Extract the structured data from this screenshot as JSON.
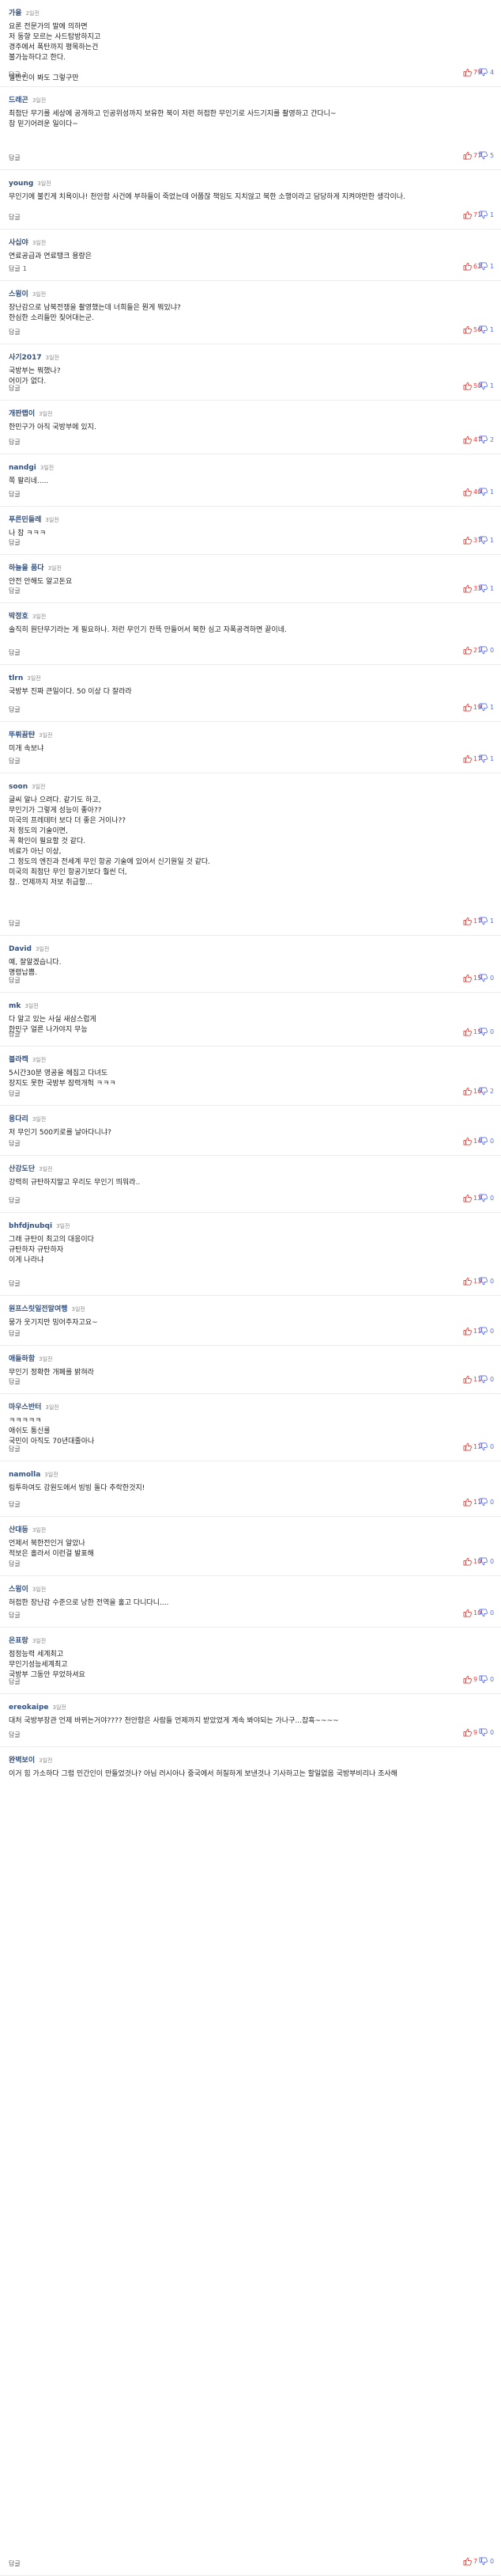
{
  "labels": {
    "reply": "답글"
  },
  "colors": {
    "like": "#e2433c",
    "dislike": "#5a6ff0",
    "nickname": "#33507e"
  },
  "comments": [
    {
      "nickname": "가을",
      "date": "2일전",
      "body": "요론 전문가의 말에 의하면\n저 동향 모르는 사드탐방하지고\n경주에서 폭탄까지 평목하는건\n불가능하다고 한다.\n\n일반인이 봐도 그렇구만",
      "reply_count": "2",
      "likes": "79",
      "dislikes": "4"
    },
    {
      "nickname": "드래곤",
      "date": "3일전",
      "body": "최첨단 무기를 세상에 공개하고 인공위성까지 보유한 북이 저런 허접한 무인기로 사드기지를 촬영하고 간다니~\n참 믿기어려운 일이다~",
      "reply_count": "",
      "likes": "77",
      "dislikes": "5"
    },
    {
      "nickname": "young",
      "date": "3일전",
      "body": "무인기에 불킨게 치욕이나! 천안함 사건에 부하들이 죽었는데 어쭙잖 책임도 지치않고 북한 소행이라고 담당하게 지켜야만한 생각이나.",
      "reply_count": "",
      "likes": "71",
      "dislikes": "1"
    },
    {
      "nickname": "사십야",
      "date": "3일전",
      "body": "연료공급과  연료탱크 용량은",
      "reply_count": "1",
      "likes": "62",
      "dislikes": "1"
    },
    {
      "nickname": "스윙이",
      "date": "3일전",
      "body": "장난감으로 남북전쟁을 촬영했는데    너희들은 뭔게 뭐있냐?\n한심한 소리들만 짖어대는군.",
      "reply_count": "",
      "likes": "56",
      "dislikes": "1"
    },
    {
      "nickname": "사기2017",
      "date": "3일전",
      "body": "국방부는 뭐했나?\n어이가 없다.",
      "reply_count": "",
      "likes": "50",
      "dislikes": "1"
    },
    {
      "nickname": "개판랩이",
      "date": "3일전",
      "body": "한민구가 아직 국방부에 있지.",
      "reply_count": "",
      "likes": "47",
      "dislikes": "2"
    },
    {
      "nickname": "nandgi",
      "date": "3일전",
      "body": "쪽 팔리네.....",
      "reply_count": "",
      "likes": "40",
      "dislikes": "1"
    },
    {
      "nickname": "푸른민들레",
      "date": "3일전",
      "body": "나 참 ㅋㅋㅋ",
      "reply_count": "",
      "likes": "37",
      "dislikes": "1"
    },
    {
      "nickname": "하늘을 품다",
      "date": "3일전",
      "body": "안전 안해도 알고돈요",
      "reply_count": "",
      "likes": "33",
      "dislikes": "1"
    },
    {
      "nickname": "박정호",
      "date": "3일전",
      "body": "솔직히 원단무기라는 게 필요하나. 저런 무인기 잔뜩 만들어서 북한 심고 자폭공격하면 끝이네.",
      "reply_count": "",
      "likes": "21",
      "dislikes": "0"
    },
    {
      "nickname": "tlrn",
      "date": "3일전",
      "body": "국방부 진짜 큰일이다. 50 이상 다 잘라라",
      "reply_count": "",
      "likes": "19",
      "dislikes": "1"
    },
    {
      "nickname": "뚜뤼뀸탼",
      "date": "3일전",
      "body": "미개 속보냐",
      "reply_count": "",
      "likes": "17",
      "dislikes": "1"
    },
    {
      "nickname": "soon",
      "date": "3일전",
      "body": "글씨 알나 으려다. 같기도 하고,\n무인기가 그렇게 성능이 좋아??\n미국의 프레데터 보다 더 좋은 거이나??\n저 정도의 기술이면,\n꼭 확인이 필요할 것 같다.\n비료가 아닌 이상,\n그 정도의 엔진과 전세계 무인 항공 기술에 있어서  신기원일 것 같다.\n미국의 최첨단 무인 항공기보다 훨씬 더,\n참.. 언제까지 저보 취급할...",
      "reply_count": "",
      "likes": "17",
      "dislikes": "1"
    },
    {
      "nickname": "David",
      "date": "3일전",
      "body": "예, 잘알겠습니다.\n명령납쁨.",
      "reply_count": "",
      "likes": "15",
      "dislikes": "0"
    },
    {
      "nickname": "mk",
      "date": "3일전",
      "body": "다 알고 있는 사실 새삼스럽게\n한민구 얼른 나가야지 무능",
      "reply_count": "",
      "likes": "15",
      "dislikes": "0"
    },
    {
      "nickname": "블라켁",
      "date": "3일전",
      "body": "5시간30분 영공을 헤집고 다녀도\n장지도 못한 국방부 잠력개헉 ㅋㅋㅋ",
      "reply_count": "",
      "likes": "16",
      "dislikes": "2"
    },
    {
      "nickname": "용다리",
      "date": "3일전",
      "body": "저 무인기 500키로를 날아다니냐?",
      "reply_count": "",
      "likes": "14",
      "dislikes": "0"
    },
    {
      "nickname": "산강도단",
      "date": "3일전",
      "body": "강력히 규탄하지말고 우리도 무인기 띄워라..",
      "reply_count": "",
      "likes": "13",
      "dislikes": "0"
    },
    {
      "nickname": "bhfdjnubqi",
      "date": "3일전",
      "body": "그래 규탄이 최고의 대응이다\n규탄하자 규탄하자\n이게 나라냐",
      "reply_count": "",
      "likes": "13",
      "dislikes": "0"
    },
    {
      "nickname": "원프스릿일전말여행",
      "date": "3일전",
      "body": "뭉가 웃기지만    밍어주자고요~",
      "reply_count": "",
      "likes": "11",
      "dislikes": "0"
    },
    {
      "nickname": "애들하함",
      "date": "3일전",
      "body": "무인기 정확한 개폐를 밝혀라",
      "reply_count": "",
      "likes": "11",
      "dislikes": "0"
    },
    {
      "nickname": "마우스반터",
      "date": "3일전",
      "body": "ㅋㅋㅋㅋㅋ\n애쉬도 통신룰\n국민이 아직도 70년대줄아나",
      "reply_count": "",
      "likes": "11",
      "dislikes": "0"
    },
    {
      "nickname": "namolla",
      "date": "3일전",
      "body": "림투하여도 강원도에서 빙빙 돌다 추락한것지!",
      "reply_count": "",
      "likes": "11",
      "dislikes": "0"
    },
    {
      "nickname": "산대등",
      "date": "3일전",
      "body": "언제서 북한전인거 알았나\n적보은 홀라서 이런걸 발표해",
      "reply_count": "",
      "likes": "10",
      "dislikes": "0"
    },
    {
      "nickname": "스윙이",
      "date": "3일전",
      "body": "허접한 장난감 수준으로  낭한 전역을 훑고 다니다니....",
      "reply_count": "",
      "likes": "10",
      "dislikes": "0"
    },
    {
      "nickname": "은표랑",
      "date": "3일전",
      "body": "점정능력 세계최고\n무인기성능세계최고\n국방부 그동안 무었하셔요",
      "reply_count": "",
      "likes": "9",
      "dislikes": "0"
    },
    {
      "nickname": "ereokaipe",
      "date": "3일전",
      "body": "대처 국방부장관 언제 바뀌는거야???? 천안함은 사람들 언제까지 받았었게 계속 봐야되는 가나구...찹흑~~~~",
      "reply_count": "",
      "likes": "9",
      "dislikes": "0"
    },
    {
      "nickname": "완벽보이",
      "date": "3일전",
      "body": "이거 힘 가소하다 그럼 민간인이 만들었것나? 아님 러시아나 중국에서 허질하게 보낸것나  기사하고는 할일없음 국방부비리나 조사해",
      "reply_count": "",
      "likes": "7",
      "dislikes": "0"
    }
  ]
}
